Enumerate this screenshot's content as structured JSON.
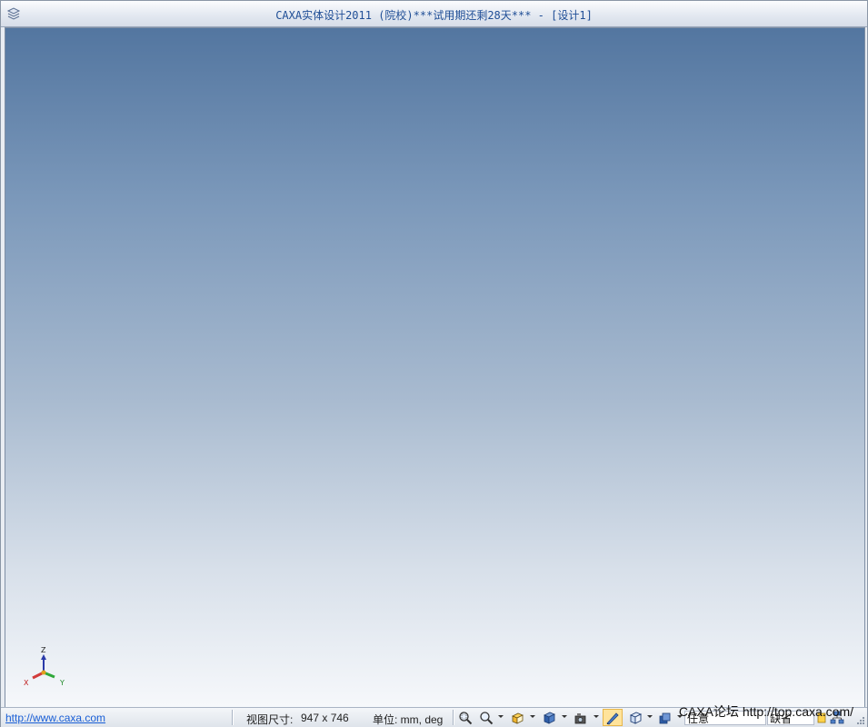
{
  "window": {
    "title": "CAXA实体设计2011 (院校)***试用期还剩28天*** - [设计1]"
  },
  "viewport": {
    "axes": {
      "x_label": "X",
      "y_label": "Y",
      "z_label": "Z"
    }
  },
  "statusbar": {
    "link": "http://www.caxa.com",
    "view_size_label": "视图尺寸:",
    "view_size_value": "947 x  746",
    "units_label": "单位: mm, deg",
    "field_left": "任意",
    "field_right": "缺省",
    "forum_text": "CAXA论坛  http://top.caxa.com/"
  },
  "toolbar_icons": [
    "zoom-window-icon",
    "zoom-icon",
    "view-orient-icon",
    "render-cube-icon",
    "camera-icon",
    "shade-icon",
    "wireframe-cube-icon",
    "layers-icon",
    "network-icon"
  ],
  "colors": {
    "title_text": "#1f4e96",
    "viewport_top": "#5376a0",
    "viewport_bottom": "#f6f8fb",
    "link": "#1a5fd6"
  }
}
